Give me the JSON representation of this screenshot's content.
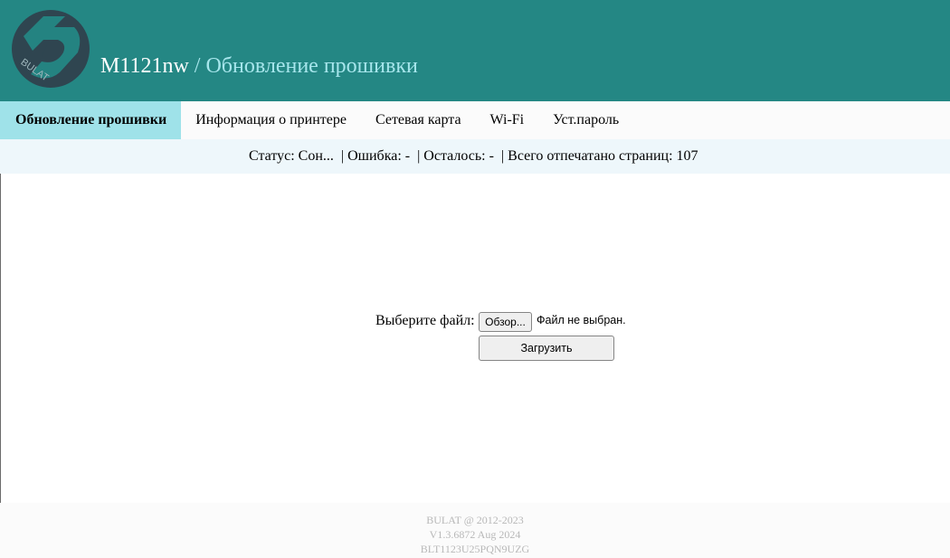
{
  "header": {
    "logo_text": "BULAT",
    "model": "M1121nw",
    "separator": " / ",
    "section_title": "Обновление прошивки",
    "colors": {
      "background": "#248784",
      "title": "#ffffff",
      "subtitle": "#a7e6ec",
      "logo": "#2f4550"
    }
  },
  "nav": {
    "items": [
      {
        "label": "Обновление прошивки",
        "active": true
      },
      {
        "label": "Информация о принтере",
        "active": false
      },
      {
        "label": "Сетевая карта",
        "active": false
      },
      {
        "label": "Wi-Fi",
        "active": false
      },
      {
        "label": "Уст.пароль",
        "active": false
      }
    ],
    "active_color": "#9fe2e9"
  },
  "status": {
    "status_label": "Статус:",
    "status_value": "Сон...",
    "error_label": "Ошибка:",
    "error_value": "-",
    "remaining_label": "Осталось:",
    "remaining_value": "-",
    "total_label": "Всего отпечатано страниц:",
    "total_value": "107"
  },
  "upload": {
    "file_label": "Выберите файл:",
    "browse_button": "Обзор...",
    "no_file_text": "Файл не выбран.",
    "submit_button": "Загрузить"
  },
  "footer": {
    "copyright": "BULAT @ 2012-2023",
    "version": "V1.3.6872 Aug 2024",
    "serial": "BLT1123U25PQN9UZG"
  }
}
